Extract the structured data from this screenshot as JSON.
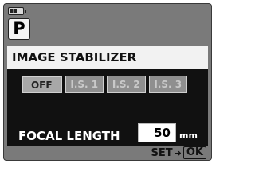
{
  "mode": "P",
  "menu": {
    "title": "IMAGE STABILIZER",
    "options": [
      {
        "label": "OFF",
        "state": "selected"
      },
      {
        "label": "I.S. 1",
        "state": "unselected"
      },
      {
        "label": "I.S. 2",
        "state": "unselected"
      },
      {
        "label": "I.S. 3",
        "state": "unselected"
      }
    ]
  },
  "focal_length": {
    "label": "FOCAL LENGTH",
    "value": "50",
    "unit": "mm"
  },
  "footer": {
    "set_label": "SET",
    "arrow": "➜",
    "ok_label": "OK"
  },
  "icons": {
    "battery": "battery-icon"
  },
  "colors": {
    "screen_bg": "#7a7a7a",
    "panel_bg": "#111111",
    "highlight_bg": "#f2f2f2"
  }
}
